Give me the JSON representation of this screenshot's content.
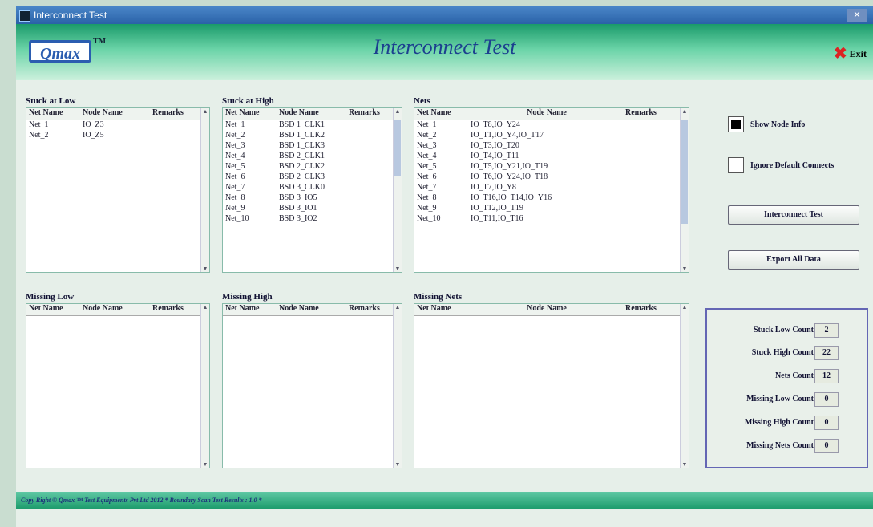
{
  "window": {
    "title": "Interconnect Test"
  },
  "header": {
    "logo": "Qmax",
    "trademark": "TM",
    "title": "Interconnect Test",
    "exit_label": "Exit"
  },
  "stuck_low": {
    "label": "Stuck at Low",
    "columns": [
      "Net Name",
      "Node Name",
      "Remarks"
    ],
    "rows": [
      [
        "Net_1",
        "IO_Z3"
      ],
      [
        "Net_2",
        "IO_Z5"
      ]
    ]
  },
  "stuck_high": {
    "label": "Stuck at High",
    "columns": [
      "Net Name",
      "Node Name",
      "Remarks"
    ],
    "rows": [
      [
        "Net_1",
        "BSD 1_CLK1"
      ],
      [
        "Net_2",
        "BSD 1_CLK2"
      ],
      [
        "Net_3",
        "BSD 1_CLK3"
      ],
      [
        "Net_4",
        "BSD 2_CLK1"
      ],
      [
        "Net_5",
        "BSD 2_CLK2"
      ],
      [
        "Net_6",
        "BSD 2_CLK3"
      ],
      [
        "Net_7",
        "BSD 3_CLK0"
      ],
      [
        "Net_8",
        "BSD 3_IO5"
      ],
      [
        "Net_9",
        "BSD 3_IO1"
      ],
      [
        "Net_10",
        "BSD 3_IO2"
      ]
    ]
  },
  "nets": {
    "label": "Nets",
    "columns": [
      "Net Name",
      "Node Name",
      "Remarks"
    ],
    "rows": [
      [
        "Net_1",
        "IO_T8,IO_Y24"
      ],
      [
        "Net_2",
        "IO_T1,IO_Y4,IO_T17"
      ],
      [
        "Net_3",
        "IO_T3,IO_T20"
      ],
      [
        "Net_4",
        "IO_T4,IO_T11"
      ],
      [
        "Net_5",
        "IO_T5,IO_Y21,IO_T19"
      ],
      [
        "Net_6",
        "IO_T6,IO_Y24,IO_T18"
      ],
      [
        "Net_7",
        "IO_T7,IO_Y8"
      ],
      [
        "Net_8",
        "IO_T16,IO_T14,IO_Y16"
      ],
      [
        "Net_9",
        "IO_T12,IO_T19"
      ],
      [
        "Net_10",
        "IO_T11,IO_T16"
      ]
    ]
  },
  "missing_low": {
    "label": "Missing Low",
    "columns": [
      "Net Name",
      "Node Name",
      "Remarks"
    ]
  },
  "missing_high": {
    "label": "Missing High",
    "columns": [
      "Net Name",
      "Node Name",
      "Remarks"
    ]
  },
  "missing_nets": {
    "label": "Missing Nets",
    "columns": [
      "Net Name",
      "Node Name",
      "Remarks"
    ]
  },
  "options": {
    "show_node_info": "Show Node Info",
    "ignore_default_connects": "Ignore Default Connects"
  },
  "buttons": {
    "interconnect_test": "Interconnect Test",
    "export_all_data": "Export All Data"
  },
  "counts": [
    {
      "label": "Stuck Low Count",
      "value": "2"
    },
    {
      "label": "Stuck High Count",
      "value": "22"
    },
    {
      "label": "Nets Count",
      "value": "12"
    },
    {
      "label": "Missing Low Count",
      "value": "0"
    },
    {
      "label": "Missing High Count",
      "value": "0"
    },
    {
      "label": "Missing Nets Count",
      "value": "0"
    }
  ],
  "footer": {
    "text": "Copy Right © Qmax ™ Test Equipments Pvt Ltd 2012 * Boundary Scan Test Results : 1.0 *"
  }
}
